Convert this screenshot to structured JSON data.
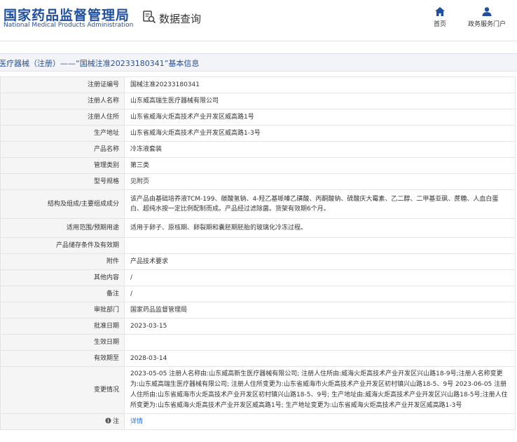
{
  "header": {
    "logo_cn": "国家药品监督管理局",
    "logo_en": "National Medical Products Administration",
    "query_label": "数据查询",
    "nav": [
      {
        "label": "首页",
        "icon": "home-icon"
      },
      {
        "label": "政务服务门户",
        "icon": "user-icon"
      }
    ]
  },
  "title": "医疗器械（注册）——“国械注准20233180341”基本信息",
  "rows": [
    {
      "label": "注册证编号",
      "value": "国械注准20233180341"
    },
    {
      "label": "注册人名称",
      "value": "山东威高瑞生医疗器械有限公司"
    },
    {
      "label": "注册人住所",
      "value": "山东省威海火炬高技术产业开发区威高路1号"
    },
    {
      "label": "生产地址",
      "value": "山东省威海火炬高技术产业开发区威高路1-3号"
    },
    {
      "label": "产品名称",
      "value": "冷冻液套装"
    },
    {
      "label": "管理类别",
      "value": "第三类"
    },
    {
      "label": "型号规格",
      "value": "见附页"
    },
    {
      "label": "结构及组成/主要组成成分",
      "value": "该产品由基础培养液TCM-199、碳酸氢钠、4-羟乙基哌嗪乙磺酸、丙酮酸钠、硫酸庆大霉素、乙二醇、二甲基亚砜、蔗糖、人血白蛋白、超纯水按一定比例配制而成。产品经过滤除菌。货架有效期6个月。"
    },
    {
      "label": "适用范围/预期用途",
      "value": "适用于卵子、原核期、卵裂期和囊胚期胚胎的玻璃化冷冻过程。"
    },
    {
      "label": "产品储存条件及有效期",
      "value": ""
    },
    {
      "label": "附件",
      "value": "产品技术要求"
    },
    {
      "label": "其他内容",
      "value": "/"
    },
    {
      "label": "备注",
      "value": "/"
    },
    {
      "label": "审批部门",
      "value": "国家药品监督管理局"
    },
    {
      "label": "批准日期",
      "value": "2023-03-15"
    },
    {
      "label": "生效日期",
      "value": ""
    },
    {
      "label": "有效期至",
      "value": "2028-03-14"
    },
    {
      "label": "变更情况",
      "value": "2023-05-05 注册人名称由:山东威高新生医疗器械有限公司; 注册人住所由:威海火炬高技术产业开发区兴山路18-9号;注册人名称变更为:山东威高瑞生医疗器械有限公司; 注册人住所变更为:山东省威海市火炬高技术产业开发区初村镇兴山路18-5、9号 2023-06-05 注册人住所由:山东省威海市火炬高技术产业开发区初村镇兴山路18-5、9号; 生产地址由:威海火炬高技术产业开发区兴山路18-5号;注册人住所变更为:山东省威海火炬高技术产业开发区威高路1号; 生产地址变更为:山东省威海火炬高技术产业开发区威高路1-3号"
    }
  ],
  "note_row": {
    "label": "注",
    "link": "详情",
    "icon": "info-icon"
  }
}
